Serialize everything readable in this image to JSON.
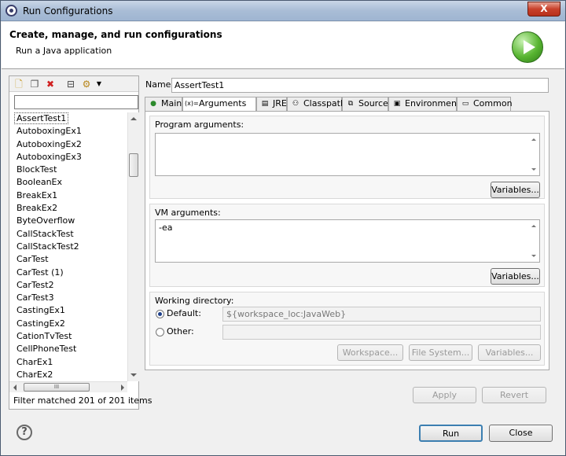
{
  "window": {
    "title": "Run Configurations",
    "close_label": "X"
  },
  "header": {
    "title": "Create, manage, and run configurations",
    "subtitle": "Run a Java application"
  },
  "left": {
    "filter_value": "",
    "items": [
      "AssertTest1",
      "AutoboxingEx1",
      "AutoboxingEx2",
      "AutoboxingEx3",
      "BlockTest",
      "BooleanEx",
      "BreakEx1",
      "BreakEx2",
      "ByteOverflow",
      "CallStackTest",
      "CallStackTest2",
      "CarTest",
      "CarTest (1)",
      "CarTest2",
      "CarTest3",
      "CastingEx1",
      "CastingEx2",
      "CationTvTest",
      "CellPhoneTest",
      "CharEx1",
      "CharEx2"
    ],
    "selected": "AssertTest1",
    "status": "Filter matched 201 of 201 items",
    "hscroll_grip": "III"
  },
  "config": {
    "name_label": "Name:",
    "name_value": "AssertTest1",
    "tabs": [
      {
        "label": "Main",
        "icon": "main-icon"
      },
      {
        "label": "Arguments",
        "icon": "arguments-icon"
      },
      {
        "label": "JRE",
        "icon": "jre-icon"
      },
      {
        "label": "Classpath",
        "icon": "classpath-icon"
      },
      {
        "label": "Source",
        "icon": "source-icon"
      },
      {
        "label": "Environment",
        "icon": "environment-icon"
      },
      {
        "label": "Common",
        "icon": "common-icon"
      }
    ],
    "active_tab": "Arguments",
    "tab_icon_glyphs": {
      "main": "●",
      "arguments": "(x)=",
      "jre": "▤",
      "classpath": "⚇",
      "source": "⧉",
      "environment": "▣",
      "common": "▭"
    },
    "program_args_label": "Program arguments:",
    "program_args_value": "",
    "vm_args_label": "VM arguments:",
    "vm_args_value": "-ea",
    "variables_label": "Variables...",
    "working_dir_label": "Working directory:",
    "default_label": "Default:",
    "default_value": "${workspace_loc:JavaWeb}",
    "other_label": "Other:",
    "other_value": "",
    "workspace_label": "Workspace...",
    "filesystem_label": "File System...",
    "apply_label": "Apply",
    "revert_label": "Revert"
  },
  "footer": {
    "help_glyph": "?",
    "run_label": "Run",
    "close_label": "Close"
  }
}
